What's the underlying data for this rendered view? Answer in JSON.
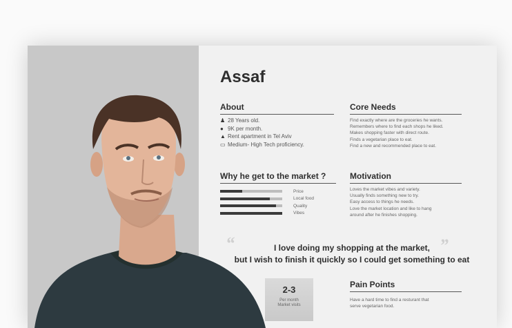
{
  "persona": {
    "name": "Assaf"
  },
  "about": {
    "heading": "About",
    "items": [
      {
        "icon": "person-icon",
        "text": "28 Years old."
      },
      {
        "icon": "money-bag-icon",
        "text": "9K per month."
      },
      {
        "icon": "home-icon",
        "text": "Rent apartment in Tel Aviv"
      },
      {
        "icon": "laptop-icon",
        "text": "Medium- High Tech proficiency."
      }
    ]
  },
  "core_needs": {
    "heading": "Core Needs",
    "lines": [
      "Find exactly where are the groceries he wants.",
      "Remembers where to find each shops he liked.",
      "Makes shopping faster with direct route.",
      "Finds a vegetarian place to eat.",
      "Find a new and recommended place to eat."
    ]
  },
  "why_market": {
    "heading": "Why he get to the market ?",
    "factors": [
      {
        "label": "Price",
        "level": 0.35
      },
      {
        "label": "Local food",
        "level": 0.8
      },
      {
        "label": "Quality",
        "level": 0.9
      },
      {
        "label": "Vibes",
        "level": 1.0
      }
    ]
  },
  "motivation": {
    "heading": "Motivation",
    "lines": [
      "Loves the market vibes and variety.",
      "Usually finds something new to try.",
      "Easy access to things he needs.",
      "Love the market location and like to hang",
      "around after he finishes shopping."
    ]
  },
  "quote": {
    "open_mark": "“",
    "close_mark": "”",
    "line1": "I love doing my shopping at the market,",
    "line2": "but I wish to finish it quickly so I could get something to eat"
  },
  "visits": {
    "value": "2-3",
    "label_line1": "Per month",
    "label_line2": "Market visits"
  },
  "pain_points": {
    "heading": "Pain Points",
    "lines": [
      "Have a hard time to find a resturant that",
      "serve vegetarian food."
    ]
  },
  "colors": {
    "accent": "#2e2e2e",
    "panel": "#c8c8c8",
    "card": "#f1f1f1"
  }
}
